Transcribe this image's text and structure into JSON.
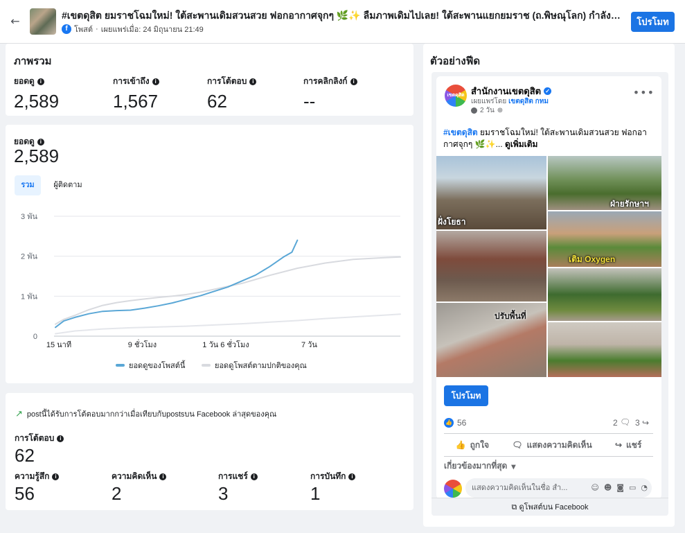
{
  "header": {
    "back_icon": "arrow-left-icon",
    "post_title": "#เขตดุสิต ยมราชโฉมใหม่! ใต้สะพานเดิมสวนสวย ฟอกอากาศจุกๆ 🌿✨ ลืมภาพเดิมไปเลย! ใต้สะพานแยกยมราช (ถ.พิษณุโลก) กำลังถูกเนรมิ...",
    "platform_icon": "facebook-icon",
    "post_type": "โพสต์",
    "published_label": "เผยแพร่เมื่อ: 24 มิถุนายน 21:49",
    "promote_label": "โปรโมท",
    "accent_color": "#1b74e4"
  },
  "overview": {
    "title": "ภาพรวม",
    "metrics": [
      {
        "label": "ยอดดู",
        "value": "2,589"
      },
      {
        "label": "การเข้าถึง",
        "value": "1,567"
      },
      {
        "label": "การโต้ตอบ",
        "value": "62"
      },
      {
        "label": "การคลิกลิงก์",
        "value": "--"
      }
    ]
  },
  "views_chart": {
    "label": "ยอดดู",
    "value": "2,589",
    "tabs": [
      {
        "label": "รวม",
        "active": true
      },
      {
        "label": "ผู้ติดตาม",
        "active": false
      }
    ],
    "legend": [
      {
        "label": "ยอดดูของโพสต์นี้",
        "color": "#5aa7d6"
      },
      {
        "label": "ยอดดูโพสต์ตามปกติของคุณ",
        "color": "#d8dadf"
      }
    ]
  },
  "chart_data": {
    "type": "line",
    "title": "",
    "xlabel": "",
    "ylabel": "",
    "x_ticks": [
      {
        "label": "15 นาที",
        "pos": 0.0
      },
      {
        "label": "9 ชั่วโมง",
        "pos": 0.3
      },
      {
        "label": "1 วัน 6 ชั่วโมง",
        "pos": 0.6
      },
      {
        "label": "7 วัน",
        "pos": 0.9
      }
    ],
    "y_ticks": [
      {
        "label": "0",
        "value": 0
      },
      {
        "label": "1 พัน",
        "value": 1000
      },
      {
        "label": "2 พัน",
        "value": 2000
      },
      {
        "label": "3 พัน",
        "value": 3000
      }
    ],
    "ylim": [
      0,
      3000
    ],
    "grid": true,
    "series": [
      {
        "name": "ยอดดูของโพสต์นี้",
        "color": "#5aa7d6",
        "points": [
          [
            0.03,
            220
          ],
          [
            0.06,
            380
          ],
          [
            0.1,
            470
          ],
          [
            0.15,
            560
          ],
          [
            0.2,
            620
          ],
          [
            0.25,
            640
          ],
          [
            0.3,
            650
          ],
          [
            0.35,
            700
          ],
          [
            0.4,
            760
          ],
          [
            0.45,
            830
          ],
          [
            0.5,
            920
          ],
          [
            0.55,
            1010
          ],
          [
            0.6,
            1120
          ],
          [
            0.65,
            1230
          ],
          [
            0.7,
            1380
          ],
          [
            0.75,
            1530
          ],
          [
            0.8,
            1740
          ],
          [
            0.85,
            1980
          ],
          [
            0.88,
            2100
          ],
          [
            0.9,
            2400
          ]
        ]
      },
      {
        "name": "ยอดดูโพสต์ตามปกติของคุณ",
        "color": "#d8dadf",
        "points": [
          [
            0.03,
            300
          ],
          [
            0.06,
            420
          ],
          [
            0.1,
            520
          ],
          [
            0.15,
            660
          ],
          [
            0.2,
            770
          ],
          [
            0.25,
            840
          ],
          [
            0.3,
            890
          ],
          [
            0.35,
            930
          ],
          [
            0.4,
            970
          ],
          [
            0.45,
            1000
          ],
          [
            0.5,
            1040
          ],
          [
            0.55,
            1100
          ],
          [
            0.6,
            1170
          ],
          [
            0.7,
            1320
          ],
          [
            0.8,
            1520
          ],
          [
            0.9,
            1700
          ],
          [
            1.0,
            1830
          ],
          [
            1.1,
            1920
          ],
          [
            1.2,
            1960
          ],
          [
            1.27,
            1980
          ]
        ]
      },
      {
        "name": "",
        "color": "#e4e6eb",
        "points": [
          [
            0.03,
            60
          ],
          [
            0.1,
            130
          ],
          [
            0.2,
            180
          ],
          [
            0.3,
            210
          ],
          [
            0.4,
            230
          ],
          [
            0.5,
            250
          ],
          [
            0.6,
            280
          ],
          [
            0.7,
            310
          ],
          [
            0.8,
            350
          ],
          [
            0.9,
            390
          ],
          [
            1.0,
            440
          ],
          [
            1.1,
            480
          ],
          [
            1.2,
            520
          ],
          [
            1.27,
            550
          ]
        ]
      }
    ]
  },
  "engagement": {
    "trend_text": "postนี้ได้รับการโต้ตอบมากกว่าเมื่อเทียบกับpostsบน Facebook ล่าสุดของคุณ",
    "trend_icon": "trending-up-icon",
    "interactions_label": "การโต้ตอบ",
    "interactions_value": "62",
    "breakdown": [
      {
        "label": "ความรู้สึก",
        "value": "56"
      },
      {
        "label": "ความคิดเห็น",
        "value": "2"
      },
      {
        "label": "การแชร์",
        "value": "3"
      },
      {
        "label": "การบันทึก",
        "value": "1"
      }
    ]
  },
  "feed_preview": {
    "title": "ตัวอย่างฟีด",
    "page_name": "สำนักงานเขตดุสิต",
    "published_by_prefix": "เผยแพร่โดย",
    "published_by": "เขตดุสิต กทม",
    "time": "2 วัน",
    "avatar_text": "เขตดุสิต",
    "post_hashtag": "#เขตดุสิต",
    "post_body": " ยมราชโฉมใหม่! ใต้สะพานเดิมสวนสวย ฟอกอากาศจุกๆ 🌿✨...",
    "see_more": "ดูเพิ่มเติม",
    "photo_captions": {
      "left_top": "ฝั่งโยธา",
      "right_top": "ฝ่ายรักษาฯ",
      "right_mid": "เติม Oxygen",
      "left_bottom": "ปรับพื้นที่"
    },
    "promote_label": "โปรโมท",
    "reaction_count": "56",
    "comment_count": "2",
    "share_count": "3",
    "actions": [
      {
        "label": "ถูกใจ",
        "icon": "thumbs-up-icon"
      },
      {
        "label": "แสดงความคิดเห็น",
        "icon": "comment-icon"
      },
      {
        "label": "แชร์",
        "icon": "share-icon"
      }
    ],
    "relevance_label": "เกี่ยวข้องมากที่สุด",
    "comment_placeholder": "แสดงความคิดเห็นในชื่อ สำ...",
    "view_on_fb": "ดูโพสต์บน Facebook"
  }
}
